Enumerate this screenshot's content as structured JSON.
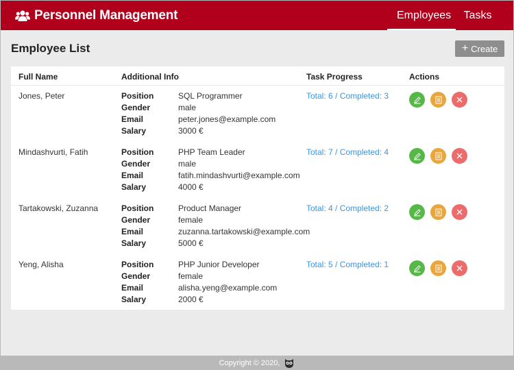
{
  "app": {
    "title": "Personnel Management",
    "logo_icon": "users-icon"
  },
  "nav": {
    "employees_label": "Employees",
    "tasks_label": "Tasks",
    "active": "Employees"
  },
  "page": {
    "title": "Employee List",
    "create_label": "Create",
    "create_icon": "plus-icon"
  },
  "table": {
    "headers": {
      "full_name": "Full Name",
      "additional_info": "Additional Info",
      "task_progress": "Task Progress",
      "actions": "Actions"
    },
    "info_keys": {
      "position": "Position",
      "gender": "Gender",
      "email": "Email",
      "salary": "Salary"
    },
    "rows": [
      {
        "name": "Jones, Peter",
        "position": "SQL Programmer",
        "gender": "male",
        "email": "peter.jones@example.com",
        "salary": "3000 €",
        "progress": "Total: 6 / Completed: 3"
      },
      {
        "name": "Mindashvurti, Fatih",
        "position": "PHP Team Leader",
        "gender": "male",
        "email": "fatih.mindashvurti@example.com",
        "salary": "4000 €",
        "progress": "Total: 7 / Completed: 4"
      },
      {
        "name": "Tartakowski, Zuzanna",
        "position": "Product Manager",
        "gender": "female",
        "email": "zuzanna.tartakowski@example.com",
        "salary": "5000 €",
        "progress": "Total: 4 / Completed: 2"
      },
      {
        "name": "Yeng, Alisha",
        "position": "PHP Junior Developer",
        "gender": "female",
        "email": "alisha.yeng@example.com",
        "salary": "2000 €",
        "progress": "Total: 5 / Completed: 1"
      }
    ],
    "action_icons": [
      "pencil-icon",
      "document-icon",
      "close-icon"
    ]
  },
  "footer": {
    "copyright": "Copyright © 2020,",
    "logo_icon": "owl-logo-icon"
  },
  "colors": {
    "header": "#b1001c",
    "link": "#3d95e0",
    "edit": "#56b947",
    "details": "#e9a63c",
    "delete": "#ec6b6b",
    "create_button": "#8e8e8e",
    "footer": "#b9b9b9"
  }
}
